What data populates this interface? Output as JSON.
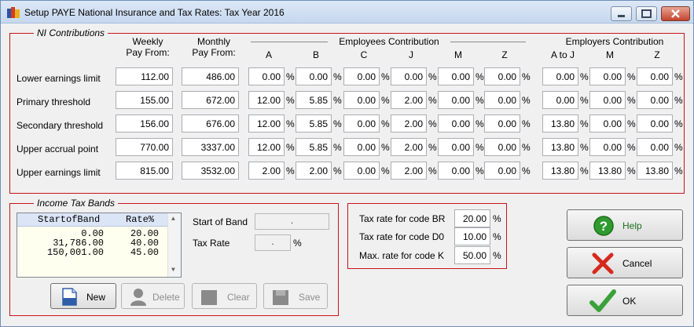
{
  "window": {
    "title": "Setup PAYE National Insurance and Tax Rates: Tax Year 2016",
    "icon": "app-icon"
  },
  "ni": {
    "group_title": "NI Contributions",
    "weekly_header": [
      "Weekly",
      "Pay From:"
    ],
    "monthly_header": [
      "Monthly",
      "Pay From:"
    ],
    "employees_header": "Employees Contribution",
    "employers_header": "Employers Contribution",
    "employee_cols": [
      "A",
      "B",
      "C",
      "J",
      "M",
      "Z"
    ],
    "employer_cols": [
      "A to J",
      "M",
      "Z"
    ],
    "percent_sign": "%",
    "rows": [
      {
        "label": "Lower earnings limit",
        "weekly": "112.00",
        "monthly": "486.00",
        "employees": [
          "0.00",
          "0.00",
          "0.00",
          "0.00",
          "0.00",
          "0.00"
        ],
        "employers": [
          "0.00",
          "0.00",
          "0.00"
        ]
      },
      {
        "label": "Primary threshold",
        "weekly": "155.00",
        "monthly": "672.00",
        "employees": [
          "12.00",
          "5.85",
          "0.00",
          "2.00",
          "0.00",
          "0.00"
        ],
        "employers": [
          "0.00",
          "0.00",
          "0.00"
        ]
      },
      {
        "label": "Secondary threshold",
        "weekly": "156.00",
        "monthly": "676.00",
        "employees": [
          "12.00",
          "5.85",
          "0.00",
          "2.00",
          "0.00",
          "0.00"
        ],
        "employers": [
          "13.80",
          "0.00",
          "0.00"
        ]
      },
      {
        "label": "Upper accrual point",
        "weekly": "770.00",
        "monthly": "3337.00",
        "employees": [
          "12.00",
          "5.85",
          "0.00",
          "2.00",
          "0.00",
          "0.00"
        ],
        "employers": [
          "13.80",
          "0.00",
          "0.00"
        ]
      },
      {
        "label": "Upper earnings limit",
        "weekly": "815.00",
        "monthly": "3532.00",
        "employees": [
          "2.00",
          "2.00",
          "0.00",
          "2.00",
          "0.00",
          "0.00"
        ],
        "employers": [
          "13.80",
          "13.80",
          "13.80"
        ]
      }
    ]
  },
  "income_tax": {
    "group_title": "Income Tax Bands",
    "list_headers": [
      "StartofBand",
      "Rate%"
    ],
    "bands": [
      {
        "start": "0.00",
        "rate": "20.00"
      },
      {
        "start": "31,786.00",
        "rate": "40.00"
      },
      {
        "start": "150,001.00",
        "rate": "45.00"
      }
    ],
    "start_of_band_label": "Start of Band",
    "start_of_band_value": ".",
    "tax_rate_label": "Tax Rate",
    "tax_rate_value": ".",
    "percent_sign": "%",
    "buttons": {
      "new": "New",
      "delete": "Delete",
      "clear": "Clear",
      "save": "Save"
    }
  },
  "rates": {
    "br_label": "Tax rate for code BR",
    "br_value": "20.00",
    "d0_label": "Tax rate for code D0",
    "d0_value": "10.00",
    "k_label": "Max. rate for code K",
    "k_value": "50.00",
    "percent_sign": "%"
  },
  "actions": {
    "help": "Help",
    "cancel": "Cancel",
    "ok": "OK"
  }
}
